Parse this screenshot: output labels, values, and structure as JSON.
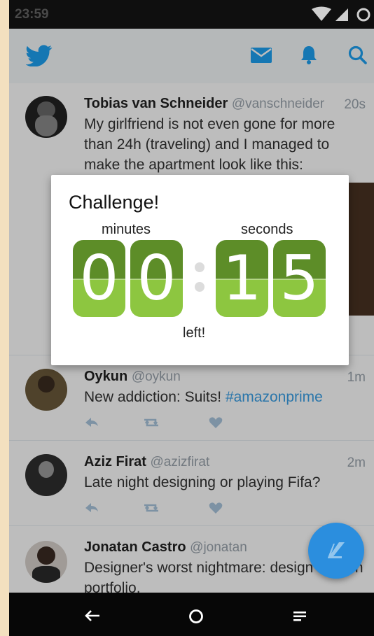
{
  "status_bar": {
    "time": "23:59"
  },
  "app_bar": {
    "logo_icon": "twitter-bird-icon",
    "icons": [
      "messages-icon",
      "notifications-icon",
      "search-icon"
    ],
    "accent_color": "#1da1f2"
  },
  "tweets": [
    {
      "name": "Tobias van Schneider",
      "handle": "@vanschneider",
      "time": "20s",
      "text": "My girlfriend is not even gone for more than 24h (traveling) and I managed to make the apartment look like this:"
    },
    {
      "name": "Oykun",
      "handle": "@oykun",
      "time": "1m",
      "text": "New addiction: Suits! ",
      "hashtag": "#amazonprime"
    },
    {
      "name": "Aziz Firat",
      "handle": "@azizfirat",
      "time": "2m",
      "text": "Late night designing or playing Fifa?"
    },
    {
      "name": "Jonatan Castro",
      "handle": "@jonatan",
      "time": "",
      "text": "Designer's worst nightmare: design its own portfolio."
    }
  ],
  "dialog": {
    "title": "Challenge!",
    "minutes_label": "minutes",
    "seconds_label": "seconds",
    "minutes": [
      "0",
      "0"
    ],
    "seconds": [
      "1",
      "5"
    ],
    "footer": "left!",
    "colors": {
      "digit_top": "#5d8d28",
      "digit_bottom": "#8dc640"
    }
  },
  "nav_bar": {
    "icons": [
      "back-icon",
      "home-icon",
      "recents-icon"
    ]
  },
  "fab": {
    "icon": "compose-icon"
  }
}
